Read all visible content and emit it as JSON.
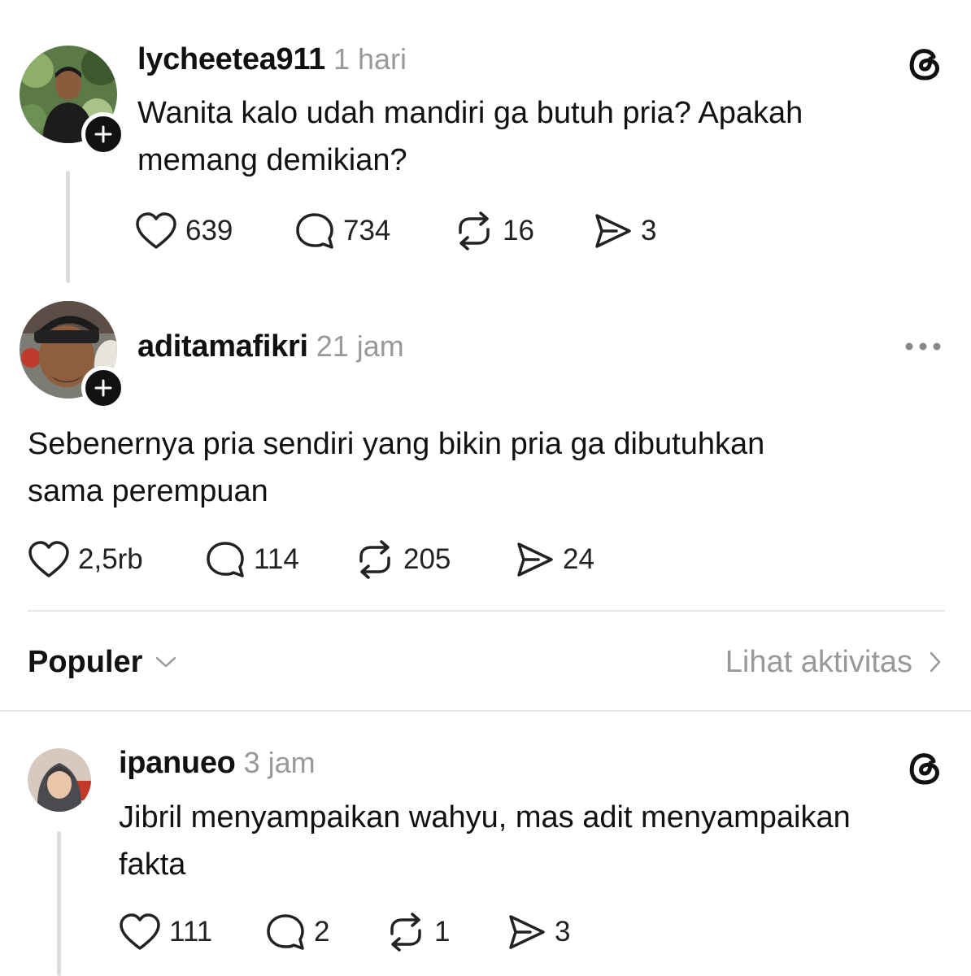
{
  "posts": [
    {
      "username": "lycheetea911",
      "time": "1 hari",
      "text_lines": [
        "Wanita kalo udah mandiri ga butuh pria? Apakah",
        "memang demikian?"
      ],
      "likes": "639",
      "replies": "734",
      "reposts": "16",
      "shares": "3"
    },
    {
      "username": "aditamafikri",
      "time": "21 jam",
      "text_lines": [
        "Sebenernya pria sendiri yang bikin pria ga dibutuhkan",
        "sama perempuan"
      ],
      "likes": "2,5rb",
      "replies": "114",
      "reposts": "205",
      "shares": "24"
    }
  ],
  "sort_bar": {
    "sort_label": "Populer",
    "activity_label": "Lihat aktivitas"
  },
  "reply": {
    "username": "ipanueo",
    "time": "3 jam",
    "text_lines": [
      "Jibril menyampaikan wahyu, mas adit menyampaikan",
      "fakta"
    ],
    "likes": "111",
    "replies": "2",
    "reposts": "1",
    "shares": "3"
  },
  "icons": {
    "like": "heart-icon",
    "reply": "speech-bubble-icon",
    "repost": "repost-icon",
    "share": "send-icon",
    "more": "more-dots-icon",
    "app": "threads-logo-icon",
    "follow": "plus-icon"
  }
}
